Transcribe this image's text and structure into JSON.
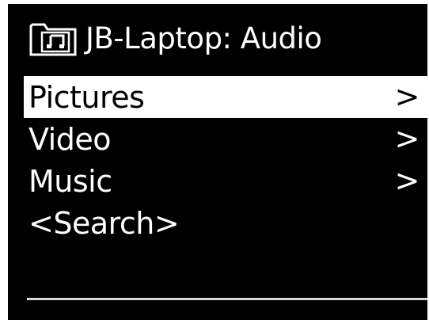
{
  "header": {
    "icon": "music-folder-icon",
    "title": "JB-Laptop: Audio"
  },
  "menu": {
    "items": [
      {
        "label": "Pictures",
        "chevron": ">",
        "selected": true
      },
      {
        "label": "Video",
        "chevron": ">",
        "selected": false
      },
      {
        "label": "Music",
        "chevron": ">",
        "selected": false
      },
      {
        "label": "<Search>",
        "chevron": "",
        "selected": false
      }
    ]
  },
  "colors": {
    "background": "#000000",
    "foreground": "#ffffff",
    "highlight": "#ffffff"
  }
}
